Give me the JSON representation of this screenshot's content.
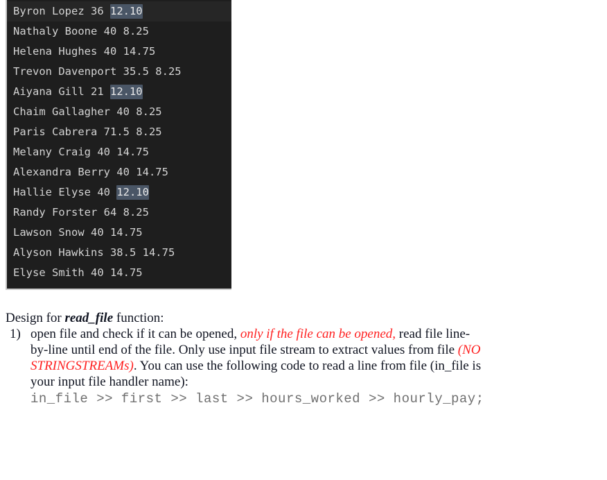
{
  "code_block": {
    "name": "employee-data-file",
    "theme": {
      "background": "#1e1e1e",
      "text": "#d4d4d4",
      "highlight_background": "#4a5666",
      "active_line_background": "#262626",
      "border": "#c9c9c9"
    },
    "highlight_value": "12.10",
    "lines": [
      {
        "prefix": "Byron Lopez 36 ",
        "highlight": "12.10",
        "suffix": "",
        "active": true
      },
      {
        "prefix": "Nathaly Boone 40 8.25",
        "highlight": "",
        "suffix": "",
        "active": false
      },
      {
        "prefix": "Helena Hughes 40 14.75",
        "highlight": "",
        "suffix": "",
        "active": false
      },
      {
        "prefix": "Trevon Davenport 35.5 8.25",
        "highlight": "",
        "suffix": "",
        "active": false
      },
      {
        "prefix": "Aiyana Gill 21 ",
        "highlight": "12.10",
        "suffix": "",
        "active": false
      },
      {
        "prefix": "Chaim Gallagher 40 8.25",
        "highlight": "",
        "suffix": "",
        "active": false
      },
      {
        "prefix": "Paris Cabrera 71.5 8.25",
        "highlight": "",
        "suffix": "",
        "active": false
      },
      {
        "prefix": "Melany Craig 40 14.75",
        "highlight": "",
        "suffix": "",
        "active": false
      },
      {
        "prefix": "Alexandra Berry 40 14.75",
        "highlight": "",
        "suffix": "",
        "active": false
      },
      {
        "prefix": "Hallie Elyse 40 ",
        "highlight": "12.10",
        "suffix": "",
        "active": false
      },
      {
        "prefix": "Randy Forster 64 8.25",
        "highlight": "",
        "suffix": "",
        "active": false
      },
      {
        "prefix": "Lawson Snow 40 14.75",
        "highlight": "",
        "suffix": "",
        "active": false
      },
      {
        "prefix": "Alyson Hawkins 38.5 14.75",
        "highlight": "",
        "suffix": "",
        "active": false
      },
      {
        "prefix": "Elyse Smith 40 14.75",
        "highlight": "",
        "suffix": "",
        "active": false
      }
    ]
  },
  "document": {
    "heading": {
      "before": "Design for ",
      "emphasis": "read_file",
      "after": " function:"
    },
    "list": {
      "marker": "1)",
      "line1": {
        "black_before": "open file and check if it can be opened, ",
        "red": "only if the file can be opened,",
        "black_after": " read file line-"
      },
      "line2": {
        "black_before": "by-line until end of the file. Only use input file stream to extract values from file ",
        "red": "(NO"
      },
      "line3": {
        "red": "STRINGSTREAMs)",
        "black_after": ". You can use the following code to read a line from file (in_file is"
      },
      "line4": "your input file handler name):",
      "code": "in_file >> first >> last >> hours_worked >> hourly_pay;"
    },
    "colors": {
      "emphasis_red": "#ff2020",
      "body_text": "#0f1320",
      "code_text": "#6f6f6f"
    }
  }
}
